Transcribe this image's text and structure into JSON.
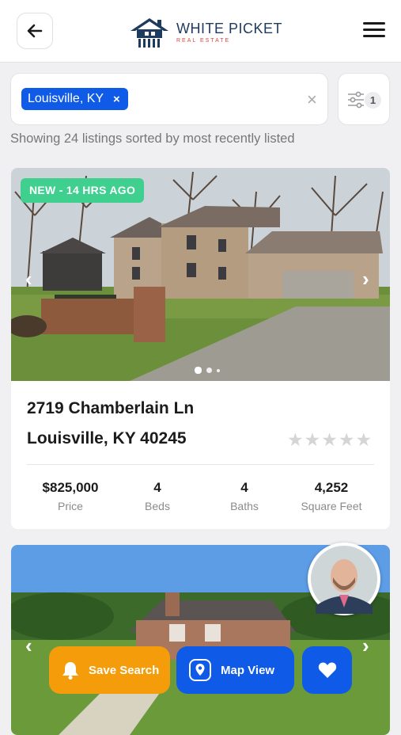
{
  "header": {
    "logo_name": "WHITE PICKET",
    "logo_sub": "REAL ESTATE"
  },
  "search": {
    "chip_label": "Louisville, KY",
    "chip_remove": "×",
    "clear": "×",
    "filter_count": "1",
    "result_text": "Showing 24 listings sorted by most recently listed"
  },
  "listings": [
    {
      "badge": "NEW - 14 HRS AGO",
      "street": "2719 Chamberlain Ln",
      "city": "Louisville, KY 40245",
      "rating": 0,
      "photo_count": 3,
      "stats": [
        {
          "value": "$825,000",
          "label": "Price"
        },
        {
          "value": "4",
          "label": "Beds"
        },
        {
          "value": "4",
          "label": "Baths"
        },
        {
          "value": "4,252",
          "label": "Square Feet"
        }
      ]
    }
  ],
  "actions": {
    "save_search": "Save Search",
    "map_view": "Map View"
  },
  "colors": {
    "accent": "#0f5be8",
    "save": "#f59c0b",
    "badge": "#3fcf8e"
  }
}
